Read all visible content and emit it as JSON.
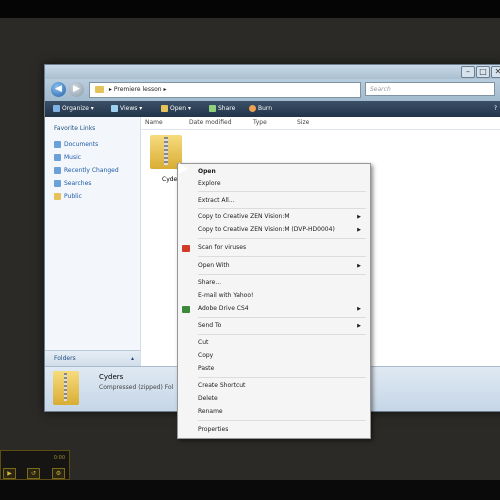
{
  "window": {
    "address_path": "Premiere lesson",
    "search_placeholder": "Search",
    "toolbar": [
      {
        "label": "Organize",
        "icon": "organize-icon"
      },
      {
        "label": "Views",
        "icon": "views-icon"
      },
      {
        "label": "Open",
        "icon": "open-icon"
      },
      {
        "label": "Share",
        "icon": "share-icon"
      },
      {
        "label": "Burn",
        "icon": "burn-icon"
      }
    ],
    "nav": {
      "header": "Favorite Links",
      "items": [
        "Documents",
        "Music",
        "Recently Changed",
        "Searches",
        "Public"
      ],
      "folders_label": "Folders"
    },
    "columns": [
      "Name",
      "Date modified",
      "Type",
      "Size"
    ],
    "file": {
      "name": "Cyde",
      "details_name": "Cyders",
      "details_type": "Compressed (zipped) Fol"
    }
  },
  "context_menu": {
    "items": [
      {
        "label": "Open",
        "bold": true
      },
      {
        "label": "Explore"
      },
      {
        "sep": true
      },
      {
        "label": "Extract All..."
      },
      {
        "sep": true
      },
      {
        "label": "Copy to Creative ZEN Vision:M",
        "submenu": true
      },
      {
        "label": "Copy to Creative ZEN Vision:M (DVP-HD0004)",
        "submenu": true
      },
      {
        "sep": true
      },
      {
        "label": "Scan for viruses",
        "icon": "antivirus-icon"
      },
      {
        "sep": true
      },
      {
        "label": "Open With",
        "submenu": true
      },
      {
        "sep": true
      },
      {
        "label": "Share..."
      },
      {
        "label": "E-mail with Yahoo!"
      },
      {
        "label": "Adobe Drive CS4",
        "submenu": true,
        "icon": "adobe-drive-icon"
      },
      {
        "sep": true
      },
      {
        "label": "Send To",
        "submenu": true
      },
      {
        "sep": true
      },
      {
        "label": "Cut"
      },
      {
        "label": "Copy"
      },
      {
        "label": "Paste"
      },
      {
        "sep": true
      },
      {
        "label": "Create Shortcut"
      },
      {
        "label": "Delete"
      },
      {
        "label": "Rename"
      },
      {
        "sep": true
      },
      {
        "label": "Properties"
      }
    ]
  },
  "player": {
    "time": "0:00"
  },
  "colors": {
    "accent": "#1e5aa8",
    "toolbar": "#2c3f56",
    "menu_bg": "#f5f5f5"
  }
}
